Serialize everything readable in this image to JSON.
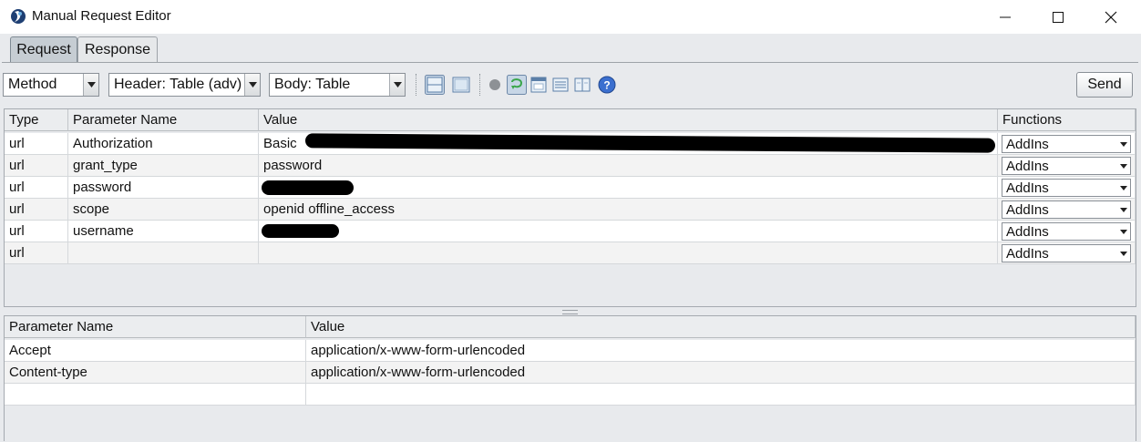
{
  "window": {
    "title": "Manual Request Editor",
    "icon": "app-logo-icon",
    "controls": [
      "minimize-icon",
      "maximize-icon",
      "close-icon"
    ]
  },
  "tabs": [
    {
      "label": "Request",
      "active": true
    },
    {
      "label": "Response",
      "active": false
    }
  ],
  "toolbar": {
    "method_select": "Method",
    "header_select": "Header: Table (adv)",
    "body_select": "Body: Table",
    "send_label": "Send",
    "icons": [
      "split-horizontal-icon",
      "single-panel-icon",
      "status-dot-icon",
      "follow-redirect-icon",
      "panel-window-icon",
      "list-view-icon",
      "columns-view-icon",
      "help-icon"
    ]
  },
  "params_table": {
    "columns": [
      "Type",
      "Parameter Name",
      "Value",
      "Functions"
    ],
    "rows": [
      {
        "type": "url",
        "name": "Authorization",
        "value": "Basic",
        "function": "AddIns"
      },
      {
        "type": "url",
        "name": "grant_type",
        "value": "password",
        "function": "AddIns"
      },
      {
        "type": "url",
        "name": "password",
        "value": "",
        "function": "AddIns"
      },
      {
        "type": "url",
        "name": "scope",
        "value": "openid offline_access",
        "function": "AddIns"
      },
      {
        "type": "url",
        "name": "username",
        "value": "",
        "function": "AddIns"
      },
      {
        "type": "url",
        "name": "",
        "value": "",
        "function": "AddIns"
      }
    ]
  },
  "headers_table": {
    "columns": [
      "Parameter Name",
      "Value"
    ],
    "rows": [
      {
        "name": "Accept",
        "value": "application/x-www-form-urlencoded"
      },
      {
        "name": "Content-type",
        "value": "application/x-www-form-urlencoded"
      },
      {
        "name": "",
        "value": ""
      }
    ]
  },
  "colors": {
    "tab_active": "#c6cdd3",
    "row_alt": "#f3f3f3",
    "help_blue": "#3b6fcf",
    "redirect_green": "#3aa64a"
  }
}
